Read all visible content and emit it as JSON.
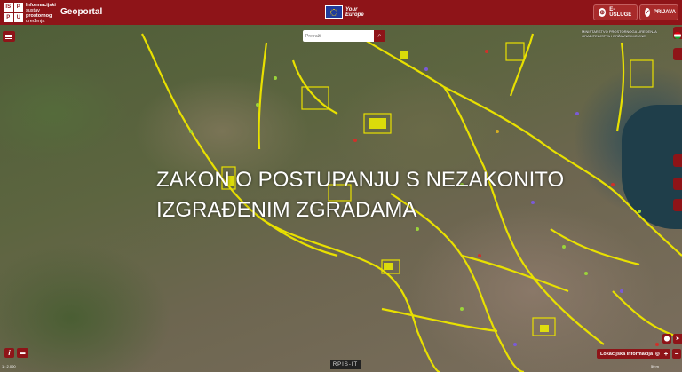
{
  "header": {
    "logo_letters": [
      "IS",
      "P",
      "P",
      "U"
    ],
    "logo_text_line1": "Informacijski",
    "logo_text_line2": "sustav",
    "logo_text_line3": "prostornog",
    "logo_text_line4": "uređenja",
    "app_title": "Geoportal",
    "eu_label_line1": "Your",
    "eu_label_line2": "Europe",
    "e_usluge_label": "E-USLUGE",
    "prijava_label": "PRIJAVA",
    "e_usluge_icon": "globe-icon",
    "prijava_icon": "check-icon"
  },
  "map": {
    "search_placeholder": "Pretraži",
    "overlay_title_line1": "ZAKON O POSTUPANJU S NEZAKONITO",
    "overlay_title_line2": "IZGRAĐENIM ZGRADAMA",
    "attribution_line1": "MINISTARSTVO PROSTORNOGA UREĐENJA",
    "attribution_line2": "GRADITELJSTVA I DRŽAVNE IMOVINE",
    "scale_left": "1 : 2,000",
    "provider_label": "RPIS-IT",
    "lokacijska_label": "Lokacijska informacija",
    "scale_right": "50 m",
    "zoom_in": "+",
    "zoom_out": "−"
  },
  "colors": {
    "brand": "#8e1418",
    "road": "#e8e000",
    "parcel": "#f0f000"
  }
}
